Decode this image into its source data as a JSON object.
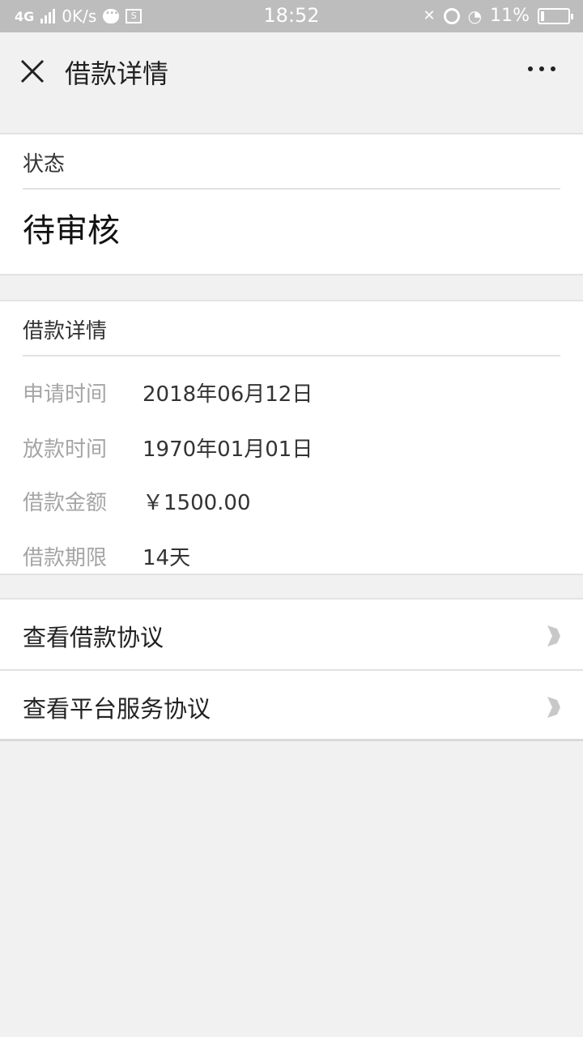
{
  "status_bar": {
    "network": "4G",
    "speed": "0K/s",
    "time": "18:52",
    "battery": "11%"
  },
  "nav": {
    "title": "借款详情",
    "close_icon": "close-icon",
    "more_icon": "more-icon"
  },
  "status_card": {
    "heading": "状态",
    "value": "待审核"
  },
  "detail_card": {
    "heading": "借款详情",
    "rows": [
      {
        "label": "申请时间",
        "value": "2018年06月12日"
      },
      {
        "label": "放款时间",
        "value": "1970年01月01日"
      },
      {
        "label": "借款金额",
        "value": "￥1500.00"
      },
      {
        "label": "借款期限",
        "value": "14天"
      }
    ]
  },
  "links": [
    {
      "label": "查看借款协议"
    },
    {
      "label": "查看平台服务协议"
    }
  ],
  "colors": {
    "status_bar_bg": "#bdbdbd",
    "page_bg": "#f1f1f1",
    "label_gray": "#a5a5a5",
    "divider": "#e2e2e2"
  }
}
